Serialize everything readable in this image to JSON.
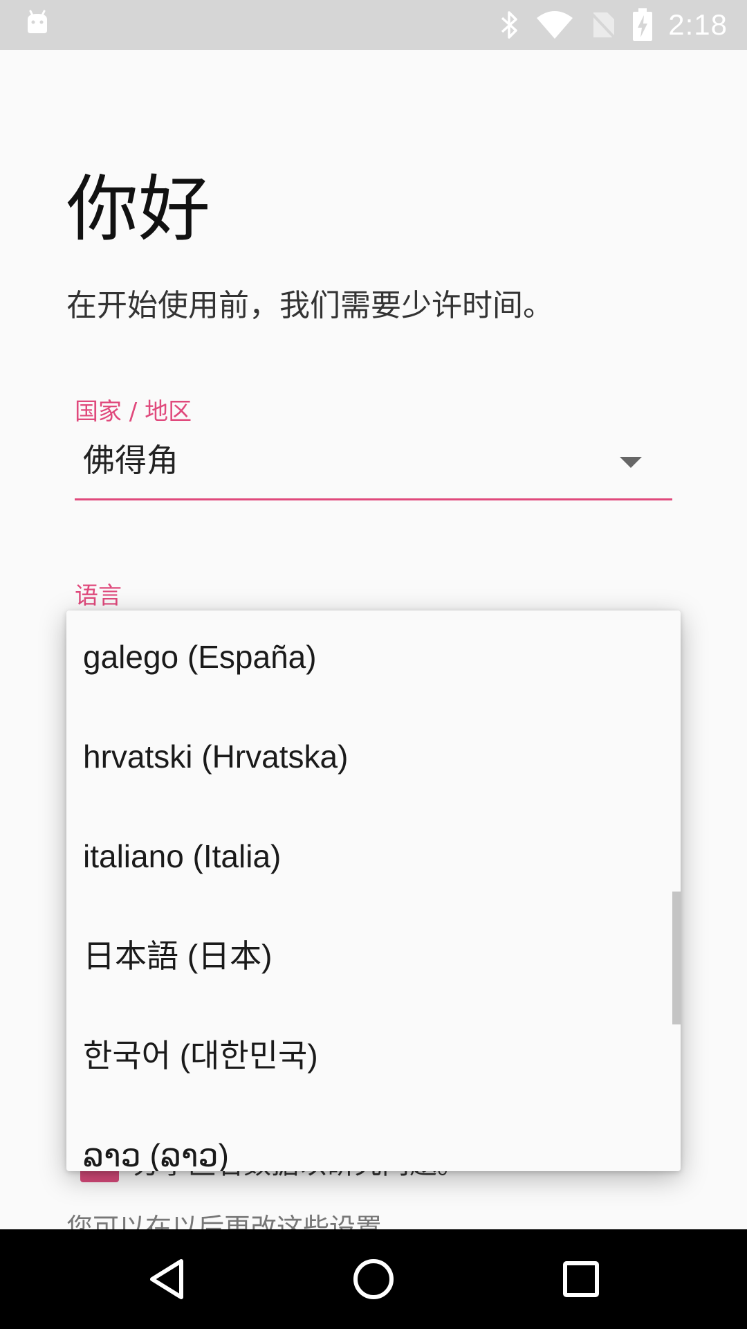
{
  "status_bar": {
    "time": "2:18",
    "icons": [
      "android-icon",
      "bluetooth-icon",
      "wifi-icon",
      "no-sim-icon",
      "battery-charging-icon"
    ]
  },
  "welcome": {
    "title": "你好",
    "subtitle": "在开始使用前，我们需要少许时间。"
  },
  "country": {
    "label": "国家 / 地区",
    "value": "佛得角"
  },
  "language": {
    "label": "语言"
  },
  "language_options": [
    "galego (España)",
    "hrvatski (Hrvatska)",
    "italiano (Italia)",
    "日本語 (日本)",
    "한국어 (대한민국)",
    "ລາວ (ລາວ)"
  ],
  "background": {
    "consent_text_partial": "分享匿名数据以研究问题。",
    "later_text_partial": "您可以在以后更改这些设置。"
  },
  "nav_bar": {
    "buttons": [
      "back-icon",
      "home-icon",
      "recents-icon"
    ]
  },
  "colors": {
    "accent": "#e0497c",
    "status_bar": "#d6d6d6",
    "nav_bar": "#000000"
  }
}
